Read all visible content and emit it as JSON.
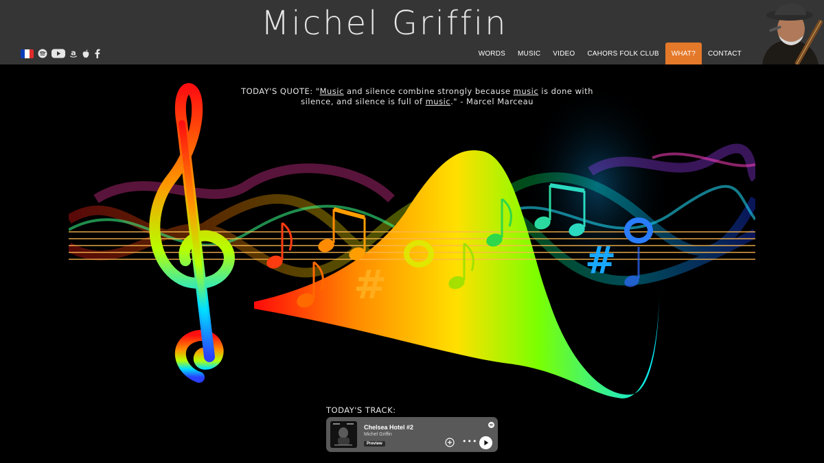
{
  "site": {
    "title": "Michel Griffin"
  },
  "social": [
    {
      "icon": "french-flag-icon"
    },
    {
      "icon": "spotify-icon"
    },
    {
      "icon": "youtube-icon"
    },
    {
      "icon": "amazon-icon"
    },
    {
      "icon": "apple-icon"
    },
    {
      "icon": "facebook-icon"
    }
  ],
  "nav": {
    "items": [
      "WORDS",
      "MUSIC",
      "VIDEO",
      "CAHORS FOLK CLUB",
      "WHAT?",
      "CONTACT"
    ],
    "active": "WHAT?"
  },
  "quote": {
    "prefix": "TODAY'S QUOTE: \"",
    "w1": "Music",
    "t1": " and silence combine strongly because ",
    "w2": "music",
    "t2": " is done with silence, and silence is full of ",
    "w3": "music",
    "t3": ".\" - Marcel Marceau"
  },
  "track": {
    "label": "TODAY'S TRACK:",
    "title": "Chelsea Hotel #2",
    "artist": "Michel Griffin",
    "badge": "Preview"
  },
  "colors": {
    "header_bg": "#353535",
    "accent": "#e4792a",
    "player_bg": "#595959"
  }
}
